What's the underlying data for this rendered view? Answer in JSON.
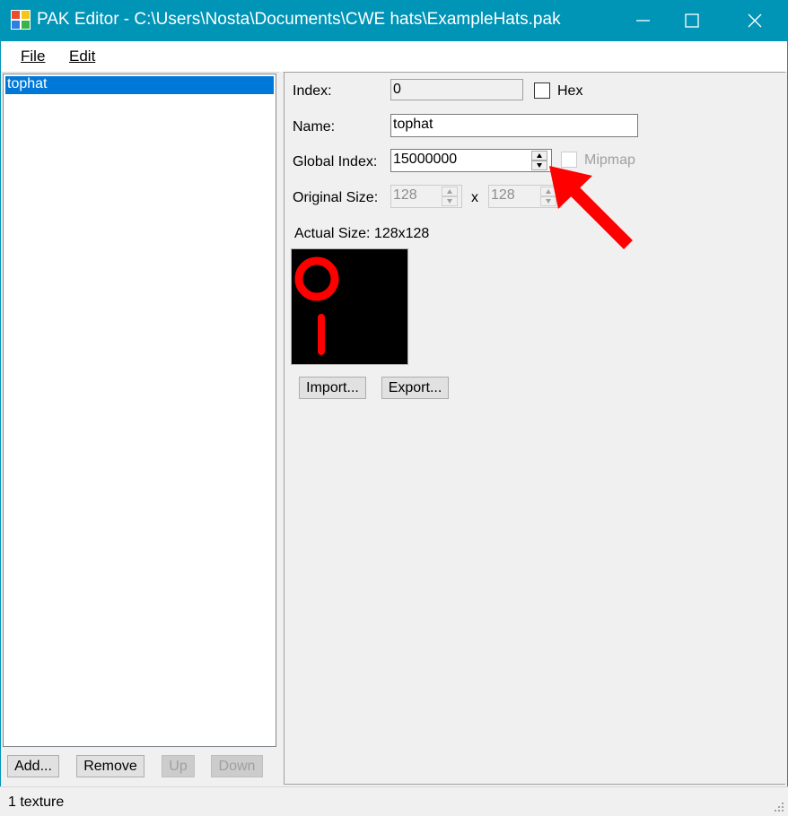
{
  "window": {
    "title": "PAK Editor - C:\\Users\\Nosta\\Documents\\CWE hats\\ExampleHats.pak",
    "accent_color": "#0094b7",
    "icons": [
      "app-icon",
      "minimize-icon",
      "maximize-icon",
      "close-icon"
    ]
  },
  "menu": {
    "file_label": "File",
    "edit_label": "Edit"
  },
  "texture_list": {
    "items": [
      "tophat"
    ],
    "selected_index": 0,
    "selection_color": "#0078d7"
  },
  "list_buttons": {
    "add": "Add...",
    "remove": "Remove",
    "up": "Up",
    "down": "Down"
  },
  "properties": {
    "index_label": "Index:",
    "index_value": "0",
    "hex_label": "Hex",
    "hex_checked": false,
    "name_label": "Name:",
    "name_value": "tophat",
    "global_index_label": "Global Index:",
    "global_index_value": "15000000",
    "mipmap_label": "Mipmap",
    "mipmap_checked": false,
    "original_size_label": "Original Size:",
    "original_width": "128",
    "size_separator": "x",
    "original_height": "128",
    "actual_size_text": "Actual Size: 128x128",
    "import_label": "Import...",
    "export_label": "Export..."
  },
  "annotation": {
    "arrow_color": "#ff0000"
  },
  "status": {
    "text": "1 texture"
  }
}
